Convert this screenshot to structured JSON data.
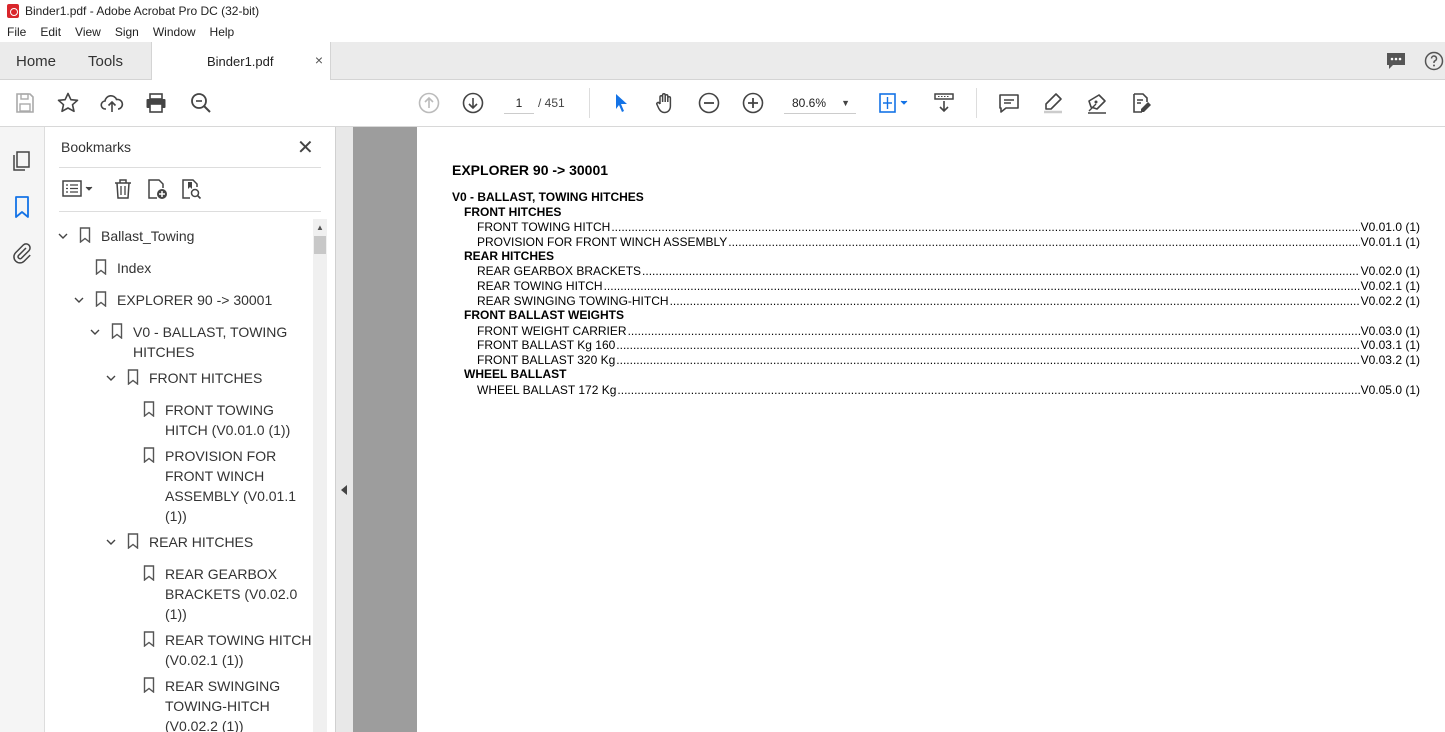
{
  "window": {
    "title": "Binder1.pdf - Adobe Acrobat Pro DC (32-bit)"
  },
  "menu": [
    "File",
    "Edit",
    "View",
    "Sign",
    "Window",
    "Help"
  ],
  "tabs": {
    "home": "Home",
    "tools": "Tools",
    "doc": "Binder1.pdf",
    "close": "×"
  },
  "toolbar": {
    "page_current": "1",
    "page_total": "/ 451",
    "zoom": "80.6%"
  },
  "bookmarks": {
    "title": "Bookmarks",
    "close": "✕",
    "items": [
      {
        "label": "Ballast_Towing"
      },
      {
        "label": "Index"
      },
      {
        "label": "EXPLORER 90 -> 30001"
      },
      {
        "label": "V0 - BALLAST, TOWING HITCHES"
      },
      {
        "label": "FRONT HITCHES"
      },
      {
        "label": "FRONT TOWING HITCH (V0.01.0 (1))"
      },
      {
        "label": "PROVISION FOR FRONT WINCH ASSEMBLY (V0.01.1 (1))"
      },
      {
        "label": "REAR HITCHES"
      },
      {
        "label": "REAR GEARBOX BRACKETS (V0.02.0 (1))"
      },
      {
        "label": "REAR TOWING HITCH (V0.02.1 (1))"
      },
      {
        "label": "REAR SWINGING TOWING-HITCH (V0.02.2 (1))"
      }
    ]
  },
  "document": {
    "heading": "EXPLORER 90 -> 30001",
    "section": "V0 - BALLAST, TOWING HITCHES",
    "groups": [
      {
        "title": "FRONT HITCHES",
        "entries": [
          {
            "text": "FRONT TOWING HITCH",
            "code": "V0.01.0 (1)"
          },
          {
            "text": "PROVISION FOR FRONT WINCH ASSEMBLY",
            "code": "V0.01.1 (1)"
          }
        ]
      },
      {
        "title": "REAR HITCHES",
        "entries": [
          {
            "text": "REAR GEARBOX BRACKETS",
            "code": "V0.02.0 (1)"
          },
          {
            "text": "REAR TOWING HITCH",
            "code": "V0.02.1 (1)"
          },
          {
            "text": "REAR SWINGING TOWING-HITCH",
            "code": "V0.02.2 (1)"
          }
        ]
      },
      {
        "title": "FRONT BALLAST WEIGHTS",
        "entries": [
          {
            "text": "FRONT WEIGHT CARRIER",
            "code": "V0.03.0 (1)"
          },
          {
            "text": "FRONT BALLAST Kg 160",
            "code": "V0.03.1 (1)"
          },
          {
            "text": "FRONT BALLAST 320 Kg",
            "code": "V0.03.2 (1)"
          }
        ]
      },
      {
        "title": "WHEEL BALLAST",
        "entries": [
          {
            "text": "WHEEL BALLAST 172 Kg",
            "code": "V0.05.0 (1)"
          }
        ]
      }
    ]
  }
}
